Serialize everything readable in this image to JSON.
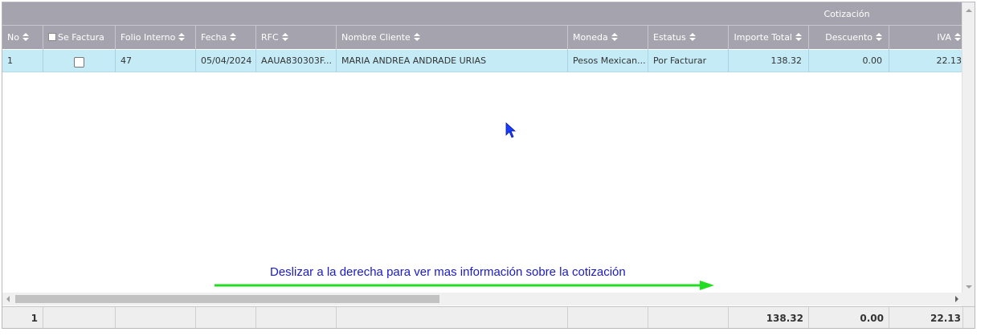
{
  "group_header": {
    "label": "Cotización"
  },
  "columns": {
    "no": "No",
    "se_factura": "Se Factura",
    "folio": "Folio Interno",
    "fecha": "Fecha",
    "rfc": "RFC",
    "cliente": "Nombre Cliente",
    "moneda": "Moneda",
    "estatus": "Estatus",
    "importe": "Importe Total",
    "descuento": "Descuento",
    "iva": "IVA"
  },
  "rows": [
    {
      "no": "1",
      "se_factura": false,
      "folio": "47",
      "fecha": "05/04/2024",
      "rfc": "AAUA830303F...",
      "cliente": "MARIA ANDREA ANDRADE URIAS",
      "moneda": "Pesos Mexican...",
      "estatus": "Por Facturar",
      "importe": "138.32",
      "descuento": "0.00",
      "iva": "22.13"
    }
  ],
  "totals": {
    "no": "1",
    "importe": "138.32",
    "descuento": "0.00",
    "iva": "22.13"
  },
  "hint": "Deslizar a la derecha para ver mas información sobre la cotización",
  "colors": {
    "header_bg": "#a5a3ad",
    "selected_row_bg": "#c5ebf7",
    "hint_text": "#1a1acc",
    "arrow": "#22dd22",
    "cursor": "#1a3cff"
  },
  "icons": {
    "sort": "sort-icon",
    "cursor": "mouse-pointer-icon",
    "arrow": "right-arrow-icon"
  }
}
